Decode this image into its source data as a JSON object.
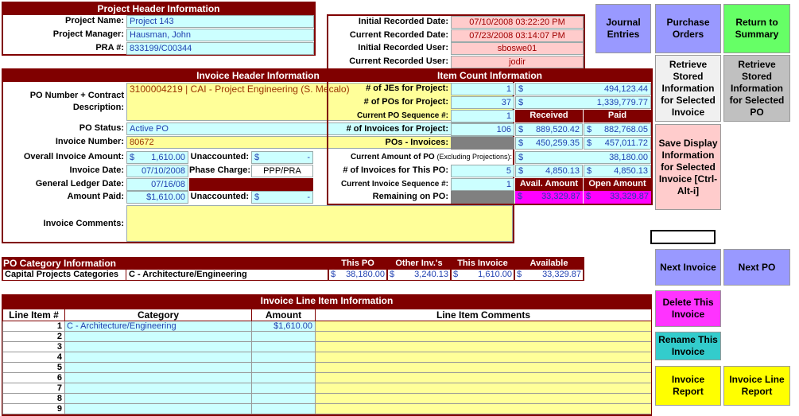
{
  "project_header": {
    "title": "Project Header Information",
    "project_name_label": "Project Name:",
    "project_name": "Project 143",
    "manager_label": "Project Manager:",
    "manager": "Hausman, John",
    "pra_label": "PRA #:",
    "pra": "833199/C00344"
  },
  "record": {
    "initial_date_label": "Initial Recorded Date:",
    "initial_date": "07/10/2008 03:22:20 PM",
    "current_date_label": "Current Recorded Date:",
    "current_date": "07/23/2008 03:14:07 PM",
    "initial_user_label": "Initial Recorded User:",
    "initial_user": "sboswe01",
    "current_user_label": "Current Recorded User:",
    "current_user": "jodir"
  },
  "invoice_header": {
    "title": "Invoice Header Information",
    "po_label": "PO Number + Contract Description:",
    "po_value": "3100004219 | CAI - Project Engineering (S. Mecalo)",
    "status_label": "PO Status:",
    "status": "Active PO",
    "inv_num_label": "Invoice Number:",
    "inv_num": "80672",
    "amount_label": "Overall Invoice Amount:",
    "amount": "1,610.00",
    "unacc_label": "Unaccounted:",
    "unacc_value": "-",
    "date_label": "Invoice Date:",
    "date": "07/10/2008",
    "phase_label": "Phase Charge:",
    "phase": "PPP/PRA",
    "gl_label": "General Ledger Date:",
    "gl_date": "07/16/08",
    "paid_label": "Amount Paid:",
    "paid": "$1,610.00",
    "unacc2_label": "Unaccounted:",
    "unacc2_value": "-",
    "comments_label": "Invoice Comments:",
    "comments": "",
    "dollar": "$"
  },
  "item_count": {
    "title": "Item Count Information",
    "jes_label": "# of JEs for Project:",
    "jes": "1",
    "jes_amt": "494,123.44",
    "pos_label": "# of POs for Project:",
    "pos": "37",
    "pos_amt": "1,339,779.77",
    "seq_label": "Current PO Sequence #:",
    "seq": "1",
    "received_label": "Received",
    "paid_label": "Paid",
    "invs_label": "# of Invoices for Project:",
    "invs": "106",
    "invs_received": "889,520.42",
    "invs_paid": "882,768.05",
    "poinv_label": "POs - Invoices:",
    "poinv_received": "450,259.35",
    "poinv_paid": "457,011.72",
    "curamt_label": "Current Amount of PO",
    "curamt_sub": "(Excluding Projections):",
    "curamt": "38,180.00",
    "invpo_label": "# of Invoices for This PO:",
    "invpo": "5",
    "invpo_a": "4,850.13",
    "invpo_b": "4,850.13",
    "curinv_label": "Current Invoice Sequence #:",
    "curinv": "1",
    "avail_label": "Avail. Amount",
    "open_label": "Open Amount",
    "remain_label": "Remaining on PO:",
    "avail": "33,329.87",
    "open": "33,329.87",
    "dollar": "$"
  },
  "buttons": {
    "journal": "Journal Entries",
    "purchase": "Purchase Orders",
    "return": "Return to Summary",
    "retrieve_invoice": "Retrieve Stored Information for Selected Invoice",
    "retrieve_po": "Retrieve Stored Information for Selected PO",
    "save": "Save Display Information for Selected Invoice [Ctrl-Alt-i]",
    "next_invoice": "Next Invoice",
    "next_po": "Next PO",
    "delete": "Delete This Invoice",
    "rename": "Rename This Invoice",
    "invoice_report": "Invoice Report",
    "line_report": "Invoice Line Report"
  },
  "po_category": {
    "title": "PO Category Information",
    "col_this_po": "This PO",
    "col_other": "Other Inv.'s",
    "col_this_inv": "This Invoice",
    "col_available": "Available",
    "row_label": "Capital Projects Categories",
    "row_category": "C - Architecture/Engineering",
    "this_po": "38,180.00",
    "other": "3,240.13",
    "this_inv": "1,610.00",
    "available": "33,329.87",
    "dollar": "$"
  },
  "line_items": {
    "title": "Invoice Line Item Information",
    "col_line": "Line Item #",
    "col_category": "Category",
    "col_amount": "Amount",
    "col_comments": "Line Item Comments",
    "rows": [
      {
        "n": "1",
        "category": "C - Architecture/Engineering",
        "amount": "$1,610.00",
        "comment": ""
      },
      {
        "n": "2",
        "category": "",
        "amount": "",
        "comment": ""
      },
      {
        "n": "3",
        "category": "",
        "amount": "",
        "comment": ""
      },
      {
        "n": "4",
        "category": "",
        "amount": "",
        "comment": ""
      },
      {
        "n": "5",
        "category": "",
        "amount": "",
        "comment": ""
      },
      {
        "n": "6",
        "category": "",
        "amount": "",
        "comment": ""
      },
      {
        "n": "7",
        "category": "",
        "amount": "",
        "comment": ""
      },
      {
        "n": "8",
        "category": "",
        "amount": "",
        "comment": ""
      },
      {
        "n": "9",
        "category": "",
        "amount": "",
        "comment": ""
      }
    ]
  },
  "colors": {
    "header_bg": "#800000",
    "field_cyan": "#ccffff",
    "field_yellow": "#ffff99",
    "magenta": "#ff00ff",
    "btn_lavender": "#9999ff",
    "btn_green": "#66ff66",
    "btn_pink": "#ffcccc",
    "btn_gray": "#c0c0c0",
    "btn_teal": "#33cccc",
    "btn_yellow": "#ffff00"
  }
}
